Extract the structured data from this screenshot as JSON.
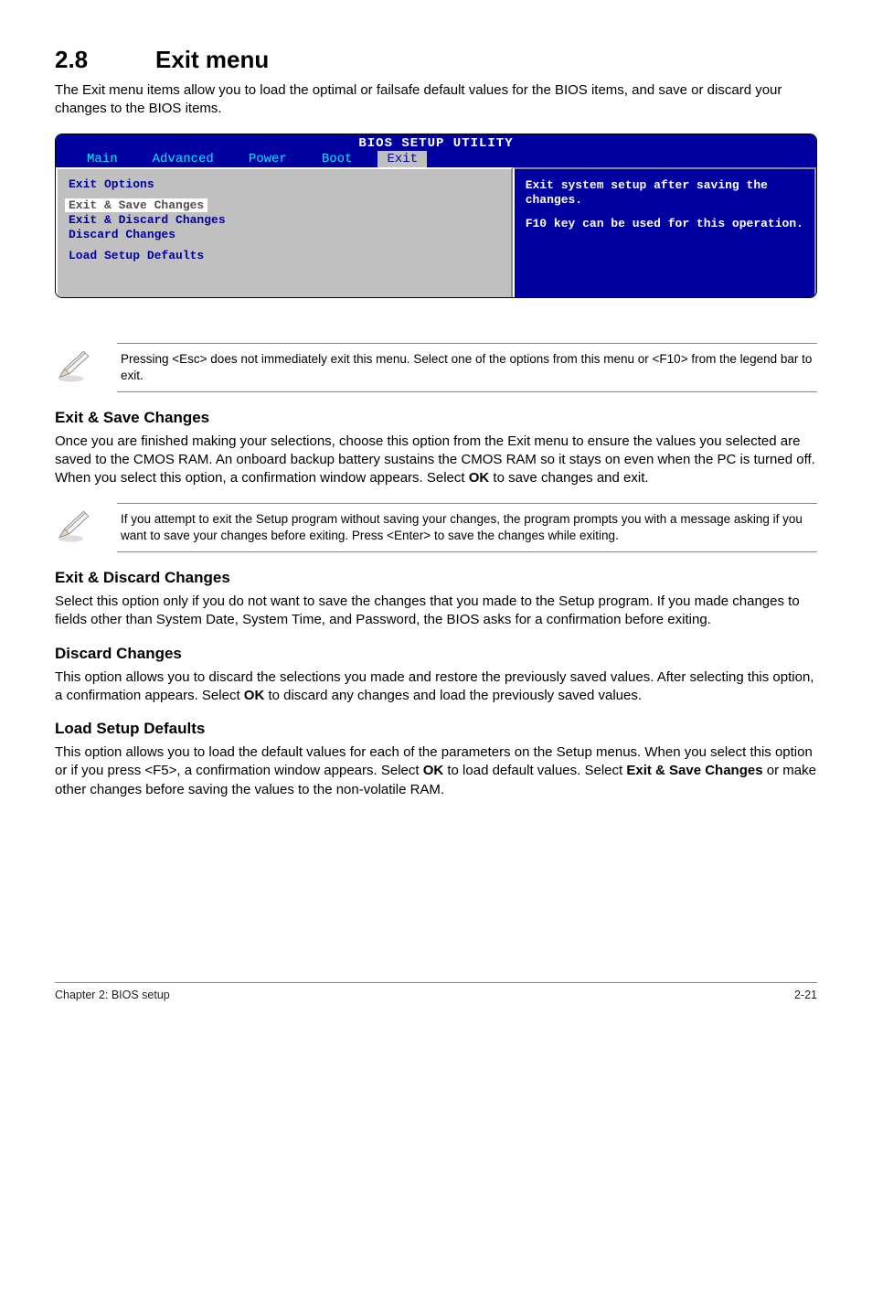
{
  "section": {
    "number": "2.8",
    "title": "Exit menu"
  },
  "intro": "The Exit menu items allow you to load the optimal or failsafe default values for the BIOS items, and save or discard your changes to the BIOS items.",
  "bios": {
    "header": "BIOS SETUP UTILITY",
    "tabs": [
      "Main",
      "Advanced",
      "Power",
      "Boot",
      "Exit"
    ],
    "active_tab_index": 4,
    "left_title": "Exit Options",
    "options": {
      "selected": "Exit & Save Changes",
      "o2": "Exit & Discard Changes",
      "o3": "Discard Changes",
      "o4": "Load Setup Defaults"
    },
    "help1": "Exit system setup after saving the changes.",
    "help2": "F10 key can be used for this operation."
  },
  "note1": "Pressing <Esc> does not immediately exit this menu. Select one of the options from this menu or <F10> from the legend bar to exit.",
  "sec1": {
    "heading": "Exit & Save Changes",
    "p_a": "Once you are finished making your selections, choose this option from the Exit menu to ensure the values you selected are saved to the CMOS RAM. An onboard backup battery sustains the CMOS RAM so it stays on even when the PC is turned off. When you select this option, a confirmation window appears. Select ",
    "p_b": "OK",
    "p_c": " to save changes and exit."
  },
  "note2": " If you attempt to exit the Setup program without saving your changes, the program prompts you with a message asking if you want to save your changes before exiting. Press <Enter>  to save the  changes while exiting.",
  "sec2": {
    "heading": "Exit & Discard Changes",
    "p": "Select this option only if you do not want to save the changes that you  made to the Setup program. If you made changes to fields other than System Date, System Time, and Password, the BIOS asks for a confirmation before exiting."
  },
  "sec3": {
    "heading": "Discard Changes",
    "p_a": "This option allows you to discard the selections you made and restore the previously saved values. After selecting this option, a confirmation appears. Select ",
    "p_b": "OK",
    "p_c": " to discard any changes and load the previously saved values."
  },
  "sec4": {
    "heading": "Load Setup Defaults",
    "p_a": "This option allows you to load the default values for each of the parameters on the Setup menus. When you select this option or if you press <F5>, a confirmation window appears. Select ",
    "p_b": "OK",
    "p_c": " to load default values. Select ",
    "p_d": "Exit & Save Changes",
    "p_e": " or make other changes before saving the values to the non-volatile RAM."
  },
  "footer": {
    "left": "Chapter 2: BIOS setup",
    "right": "2-21"
  }
}
